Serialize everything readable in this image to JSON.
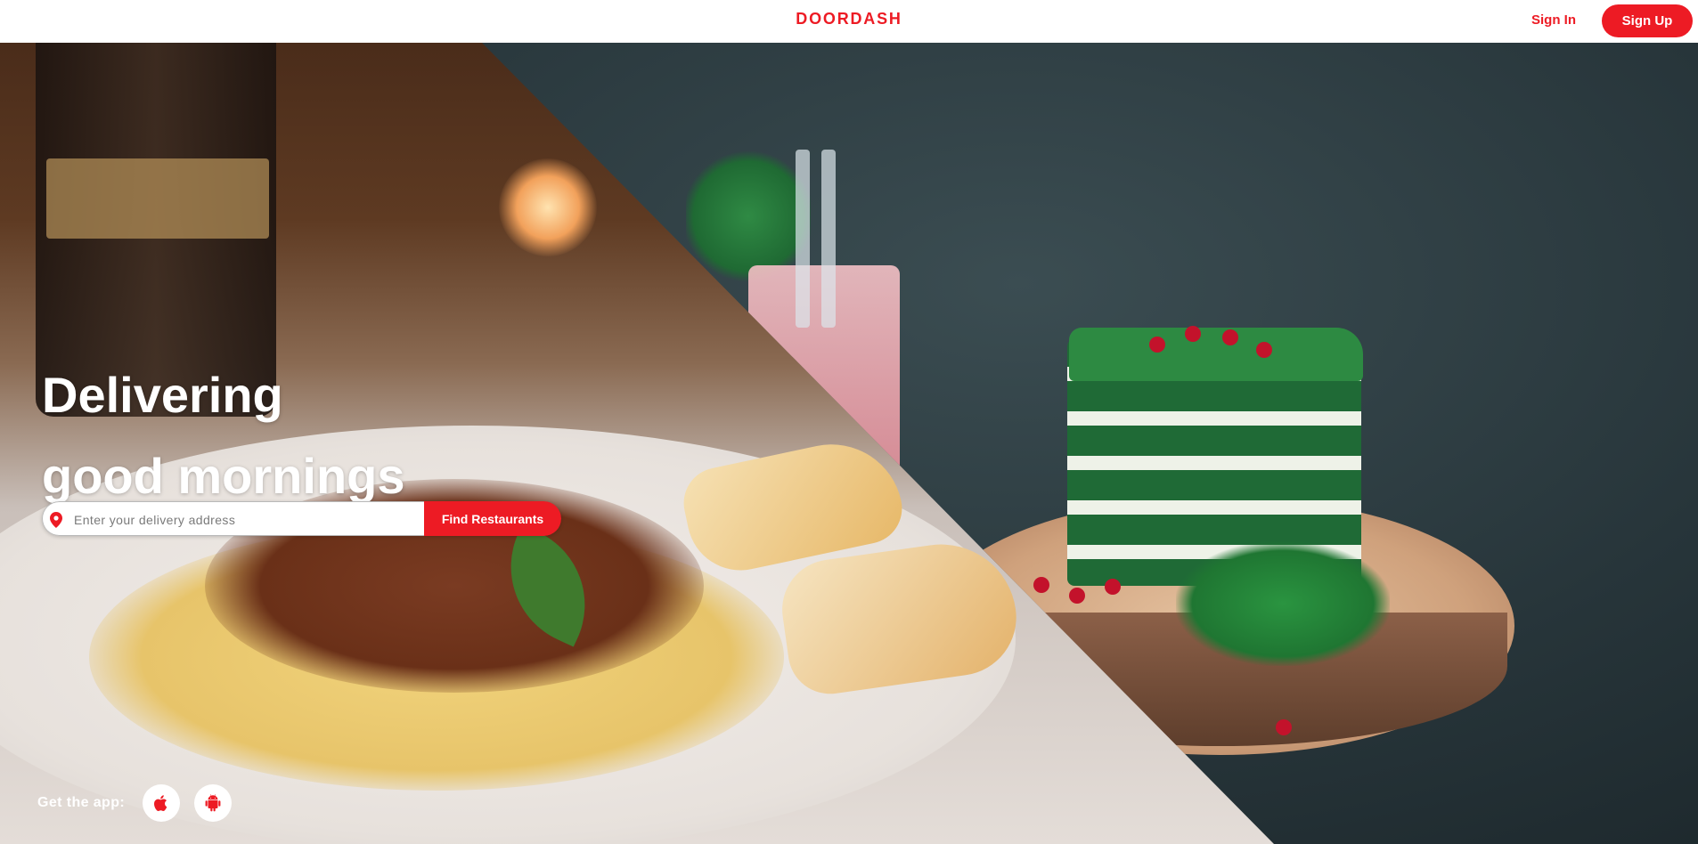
{
  "header": {
    "brand": "DOORDASH",
    "sign_in": "Sign In",
    "sign_up": "Sign Up"
  },
  "hero": {
    "headline_line1": "Delivering",
    "headline_line2": "good mornings",
    "address_placeholder": "Enter your delivery address",
    "find_button": "Find Restaurants",
    "get_app": "Get the app:"
  },
  "icons": {
    "location": "location-pin-icon",
    "ios": "apple-icon",
    "android": "android-icon"
  },
  "colors": {
    "accent": "#ed1b24"
  }
}
